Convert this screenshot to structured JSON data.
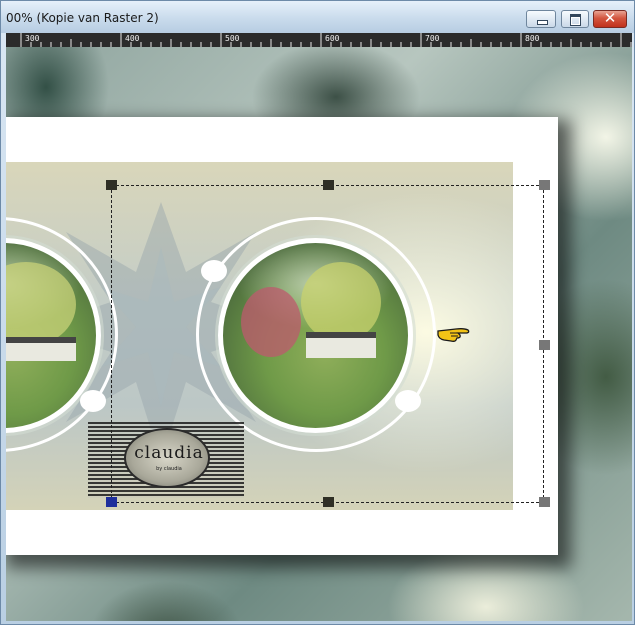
{
  "window": {
    "title": "00% (Kopie van Raster 2)",
    "buttons": {
      "minimize": "minimize",
      "maximize": "maximize",
      "close": "✕"
    }
  },
  "ruler": {
    "labels": [
      "300",
      "400",
      "500",
      "600",
      "700",
      "800"
    ]
  },
  "canvas": {
    "watermark_text": "claudia",
    "watermark_subtext": "by claudia"
  },
  "icons": {
    "pointer": "pointing-hand-icon"
  },
  "colors": {
    "ruler_bg": "#2b2b2b",
    "selection_handle": "#2f2f25",
    "close_button": "#c0311c"
  }
}
